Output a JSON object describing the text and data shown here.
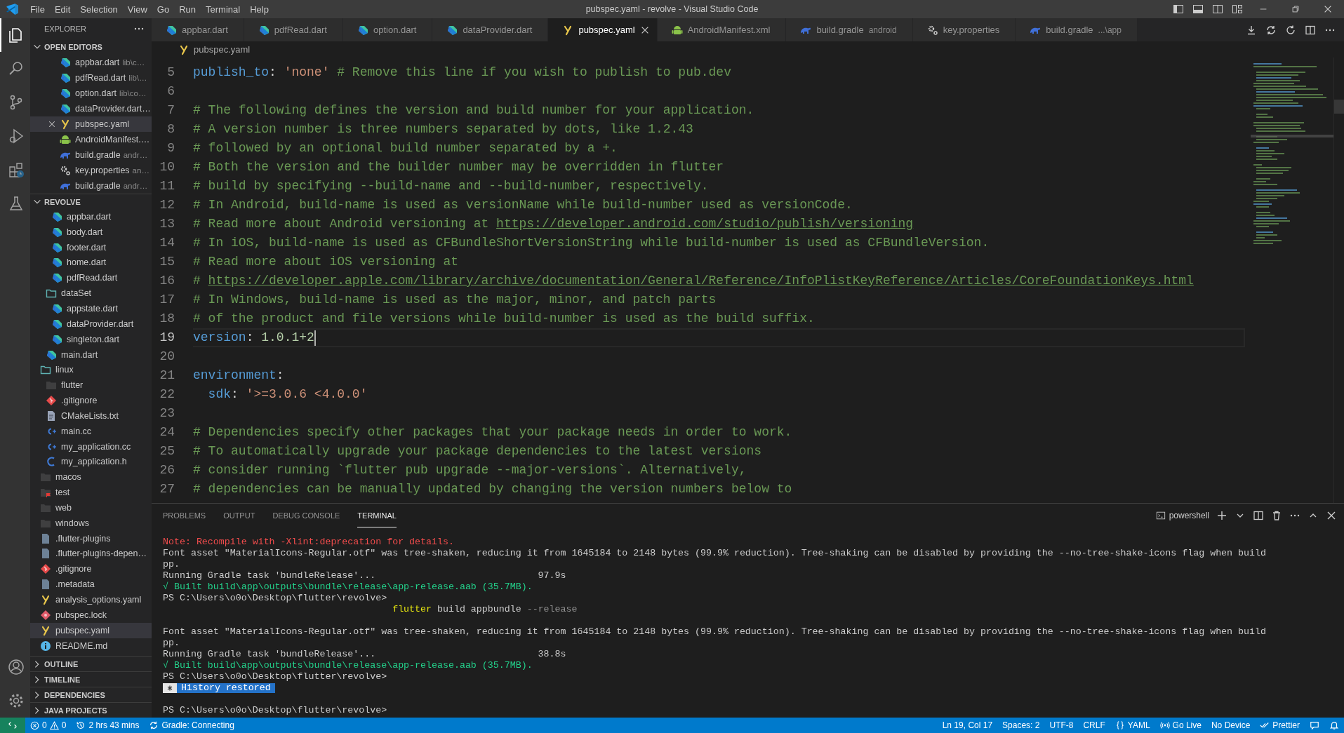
{
  "menu": [
    "File",
    "Edit",
    "Selection",
    "View",
    "Go",
    "Run",
    "Terminal",
    "Help"
  ],
  "window": {
    "title": "pubspec.yaml - revolve - Visual Studio Code"
  },
  "activity_bar": [
    {
      "kind": "explorer",
      "selected": true
    },
    {
      "kind": "search",
      "selected": false
    },
    {
      "kind": "source-control",
      "selected": false
    },
    {
      "kind": "run-debug",
      "selected": false
    },
    {
      "kind": "extensions",
      "selected": false
    },
    {
      "kind": "testing",
      "selected": false
    }
  ],
  "activity_bar_bottom": [
    {
      "kind": "account"
    },
    {
      "kind": "settings"
    }
  ],
  "sidebar": {
    "title": "EXPLORER",
    "open_editors": {
      "title": "OPEN EDITORS",
      "expanded": true,
      "items": [
        {
          "name": "appbar.dart",
          "description": "lib\\c…",
          "kind": "dart",
          "selected": false
        },
        {
          "name": "pdfRead.dart",
          "description": "lib\\…",
          "kind": "dart",
          "selected": false
        },
        {
          "name": "option.dart",
          "description": "lib\\co…",
          "kind": "dart",
          "selected": false
        },
        {
          "name": "dataProvider.dart…",
          "kind": "dart",
          "selected": false
        },
        {
          "name": "pubspec.yaml",
          "kind": "yaml",
          "selected": true
        },
        {
          "name": "AndroidManifest.…",
          "kind": "android",
          "selected": false
        },
        {
          "name": "build.gradle",
          "description": "andr…",
          "kind": "gradle",
          "selected": false
        },
        {
          "name": "key.properties",
          "description": "an…",
          "kind": "gear",
          "selected": false
        },
        {
          "name": "build.gradle",
          "description": "andr…",
          "kind": "gradle",
          "selected": false
        }
      ]
    },
    "project": {
      "title": "REVOLVE",
      "expanded": true,
      "tree": [
        {
          "children": [
            {
              "children": [
                {
                  "name": "appbar.dart",
                  "kind": "dart",
                  "selected": false
                },
                {
                  "name": "body.dart",
                  "kind": "dart",
                  "selected": false
                },
                {
                  "name": "footer.dart",
                  "kind": "dart",
                  "selected": false
                },
                {
                  "name": "home.dart",
                  "kind": "dart",
                  "selected": false
                },
                {
                  "name": "pdfRead.dart",
                  "kind": "dart",
                  "selected": false
                }
              ]
            },
            {
              "name": "dataSet",
              "kind": "folder",
              "expanded": true,
              "selected": false,
              "children": [
                {
                  "name": "appstate.dart",
                  "kind": "dart",
                  "selected": false
                },
                {
                  "name": "dataProvider.dart",
                  "kind": "dart",
                  "selected": false
                },
                {
                  "name": "singleton.dart",
                  "kind": "dart",
                  "selected": false
                }
              ]
            },
            {
              "name": "main.dart",
              "kind": "dart",
              "selected": false
            }
          ]
        },
        {
          "name": "linux",
          "kind": "folder",
          "expanded": true,
          "selected": false,
          "children": [
            {
              "name": "flutter",
              "kind": "folder",
              "expanded": false,
              "selected": false
            },
            {
              "name": ".gitignore",
              "kind": "git",
              "selected": false
            },
            {
              "name": "CMakeLists.txt",
              "kind": "text",
              "selected": false
            },
            {
              "name": "main.cc",
              "kind": "cpp",
              "selected": false
            },
            {
              "name": "my_application.cc",
              "kind": "cpp",
              "selected": false
            },
            {
              "name": "my_application.h",
              "kind": "c",
              "selected": false
            }
          ]
        },
        {
          "name": "macos",
          "kind": "folder",
          "expanded": false,
          "selected": false
        },
        {
          "name": "test",
          "kind": "test-folder",
          "expanded": false,
          "selected": false
        },
        {
          "name": "web",
          "kind": "folder",
          "expanded": false,
          "selected": false
        },
        {
          "name": "windows",
          "kind": "folder",
          "expanded": false,
          "selected": false
        },
        {
          "name": ".flutter-plugins",
          "kind": "file",
          "selected": false
        },
        {
          "name": ".flutter-plugins-depen…",
          "kind": "file",
          "selected": false
        },
        {
          "name": ".gitignore",
          "kind": "git",
          "selected": false
        },
        {
          "name": ".metadata",
          "kind": "file",
          "selected": false
        },
        {
          "name": "analysis_options.yaml",
          "kind": "yaml",
          "selected": false
        },
        {
          "name": "pubspec.lock",
          "kind": "lock",
          "selected": false
        },
        {
          "name": "pubspec.yaml",
          "kind": "yaml",
          "selected": true
        },
        {
          "name": "README.md",
          "kind": "info",
          "selected": false
        }
      ]
    },
    "sections": [
      {
        "title": "OUTLINE",
        "expanded": false
      },
      {
        "title": "TIMELINE",
        "expanded": false
      },
      {
        "title": "DEPENDENCIES",
        "expanded": false
      },
      {
        "title": "JAVA PROJECTS",
        "expanded": false
      }
    ]
  },
  "tabs": [
    {
      "label": "appbar.dart",
      "kind": "dart",
      "selected": false
    },
    {
      "label": "pdfRead.dart",
      "kind": "dart",
      "selected": false
    },
    {
      "label": "option.dart",
      "kind": "dart",
      "selected": false
    },
    {
      "label": "dataProvider.dart",
      "kind": "dart",
      "selected": false
    },
    {
      "label": "pubspec.yaml",
      "kind": "yaml",
      "selected": true
    },
    {
      "label": "AndroidManifest.xml",
      "kind": "android",
      "selected": false
    },
    {
      "label": "build.gradle",
      "description": "android",
      "kind": "gradle",
      "selected": false
    },
    {
      "label": "key.properties",
      "kind": "gear",
      "selected": false
    },
    {
      "label": "build.gradle",
      "description": "...\\app",
      "kind": "gradle",
      "selected": false
    }
  ],
  "breadcrumb": {
    "label": "pubspec.yaml",
    "kind": "yaml"
  },
  "editor": {
    "lines": [
      {
        "num": "5",
        "kind": "top",
        "current": false,
        "tokens": [
          {
            "kind": "key",
            "text": "publish_to"
          },
          {
            "kind": "punct",
            "text": ": "
          },
          {
            "kind": "string",
            "text": "'none'"
          },
          {
            "kind": "comment",
            "text": " # Remove this line if you wish to publish to pub.dev"
          }
        ]
      },
      {
        "num": "6",
        "kind": "top",
        "current": false
      },
      {
        "num": "7",
        "kind": "top",
        "current": false,
        "tokens": [
          {
            "kind": "comment",
            "text": "# The following defines the version and build number for your application."
          }
        ]
      },
      {
        "num": "8",
        "kind": "top",
        "current": false,
        "tokens": [
          {
            "kind": "comment",
            "text": "# A version number is three numbers separated by dots, like 1.2.43"
          }
        ]
      },
      {
        "num": "9",
        "kind": "top",
        "current": false,
        "tokens": [
          {
            "kind": "comment",
            "text": "# followed by an optional build number separated by a +."
          }
        ]
      },
      {
        "num": "10",
        "kind": "top",
        "current": false,
        "tokens": [
          {
            "kind": "comment",
            "text": "# Both the version and the builder number may be overridden in flutter"
          }
        ]
      },
      {
        "num": "11",
        "kind": "top",
        "current": false,
        "tokens": [
          {
            "kind": "comment",
            "text": "# build by specifying --build-name and --build-number, respectively."
          }
        ]
      },
      {
        "num": "12",
        "kind": "top",
        "current": false,
        "tokens": [
          {
            "kind": "comment",
            "text": "# In Android, build-name is used as versionName while build-number used as versionCode."
          }
        ]
      },
      {
        "num": "13",
        "kind": "top",
        "current": false,
        "tokens": [
          {
            "kind": "comment",
            "text": "# Read more about Android versioning at "
          },
          {
            "kind": "link",
            "text": "https://developer.android.com/studio/publish/versioning"
          }
        ]
      },
      {
        "num": "14",
        "kind": "top",
        "current": false,
        "tokens": [
          {
            "kind": "comment",
            "text": "# In iOS, build-name is used as CFBundleShortVersionString while build-number is used as CFBundleVersion."
          }
        ]
      },
      {
        "num": "15",
        "kind": "top",
        "current": false,
        "tokens": [
          {
            "kind": "comment",
            "text": "# Read more about iOS versioning at"
          }
        ]
      },
      {
        "num": "16",
        "kind": "top",
        "current": false,
        "tokens": [
          {
            "kind": "comment",
            "text": "# "
          },
          {
            "kind": "link",
            "text": "https://developer.apple.com/library/archive/documentation/General/Reference/InfoPlistKeyReference/Articles/CoreFoundationKeys.html"
          }
        ]
      },
      {
        "num": "17",
        "kind": "top",
        "current": false,
        "tokens": [
          {
            "kind": "comment",
            "text": "# In Windows, build-name is used as the major, minor, and patch parts"
          }
        ]
      },
      {
        "num": "18",
        "kind": "top",
        "current": false,
        "tokens": [
          {
            "kind": "comment",
            "text": "# of the product and file versions while build-number is used as the build suffix."
          }
        ]
      },
      {
        "num": "19",
        "kind": "top",
        "current": true,
        "tokens": [
          {
            "kind": "key",
            "text": "version"
          },
          {
            "kind": "punct",
            "text": ": "
          },
          {
            "kind": "number",
            "text": "1.0.1+2"
          }
        ]
      },
      {
        "num": "20",
        "kind": "top",
        "current": false
      },
      {
        "num": "21",
        "kind": "top",
        "current": false,
        "tokens": [
          {
            "kind": "key",
            "text": "environment"
          },
          {
            "kind": "punct",
            "text": ":"
          }
        ]
      },
      {
        "num": "22",
        "kind": "nested",
        "current": false,
        "tokens": [
          {
            "kind": "key",
            "text": "sdk"
          },
          {
            "kind": "punct",
            "text": ": "
          },
          {
            "kind": "string",
            "text": "'>=3.0.6 <4.0.0'"
          }
        ]
      },
      {
        "num": "23",
        "kind": "top",
        "current": false
      },
      {
        "num": "24",
        "kind": "top",
        "current": false,
        "tokens": [
          {
            "kind": "comment",
            "text": "# Dependencies specify other packages that your package needs in order to work."
          }
        ]
      },
      {
        "num": "25",
        "kind": "top",
        "current": false,
        "tokens": [
          {
            "kind": "comment",
            "text": "# To automatically upgrade your package dependencies to the latest versions"
          }
        ]
      },
      {
        "num": "26",
        "kind": "top",
        "current": false,
        "tokens": [
          {
            "kind": "comment",
            "text": "# consider running `flutter pub upgrade --major-versions`. Alternatively,"
          }
        ]
      },
      {
        "num": "27",
        "kind": "top",
        "current": false,
        "tokens": [
          {
            "kind": "comment",
            "text": "# dependencies can be manually updated by changing the version numbers below to"
          }
        ]
      }
    ]
  },
  "panel": {
    "tabs": [
      {
        "label": "PROBLEMS",
        "selected": false
      },
      {
        "label": "OUTPUT",
        "selected": false
      },
      {
        "label": "DEBUG CONSOLE",
        "selected": false
      },
      {
        "label": "TERMINAL",
        "selected": true
      }
    ],
    "terminal_name": "powershell",
    "terminal": [
      {
        "kind": "error",
        "text": "Note: Recompile with -Xlint:deprecation for details."
      },
      {
        "kind": "output",
        "text": "Font asset \"MaterialIcons-Regular.otf\" was tree-shaken, reducing it from 1645184 to 2148 bytes (99.9% reduction). Tree-shaking can be disabled by providing the --no-tree-shake-icons flag when build"
      },
      {
        "kind": "output",
        "text": "pp."
      },
      {
        "kind": "timed",
        "text": "Running Gradle task 'bundleRelease'...",
        "time": "97.9s"
      },
      {
        "kind": "success",
        "text": "√ Built build\\app\\outputs\\bundle\\release\\app-release.aab (35.7MB)."
      },
      {
        "kind": "output",
        "text": "PS C:\\Users\\o0o\\Desktop\\flutter\\revolve>"
      },
      {
        "kind": "command",
        "tokens": [
          {
            "kind": "exe",
            "text": "flutter"
          },
          {
            "kind": "arg",
            "text": " build appbundle "
          },
          {
            "kind": "flag",
            "text": "--release"
          }
        ]
      },
      {
        "kind": "blank"
      },
      {
        "kind": "output",
        "text": "Font asset \"MaterialIcons-Regular.otf\" was tree-shaken, reducing it from 1645184 to 2148 bytes (99.9% reduction). Tree-shaking can be disabled by providing the --no-tree-shake-icons flag when build"
      },
      {
        "kind": "output",
        "text": "pp."
      },
      {
        "kind": "timed",
        "text": "Running Gradle task 'bundleRelease'...",
        "time": "38.8s"
      },
      {
        "kind": "success",
        "text": "√ Built build\\app\\outputs\\bundle\\release\\app-release.aab (35.7MB)."
      },
      {
        "kind": "output",
        "text": "PS C:\\Users\\o0o\\Desktop\\flutter\\revolve>"
      },
      {
        "kind": "badge",
        "text": "History restored"
      },
      {
        "kind": "blank"
      },
      {
        "kind": "output",
        "text": "PS C:\\Users\\o0o\\Desktop\\flutter\\revolve>"
      }
    ]
  },
  "status_bar": {
    "left": [
      {
        "kind": "remote"
      },
      {
        "kind": "problems",
        "errors": "0",
        "warnings": "0"
      },
      {
        "kind": "history",
        "text": "2 hrs 43 mins"
      },
      {
        "kind": "sync",
        "text": "Gradle: Connecting"
      }
    ],
    "right": [
      {
        "kind": "text",
        "text": "Ln 19, Col 17"
      },
      {
        "kind": "text",
        "text": "Spaces: 2"
      },
      {
        "kind": "text",
        "text": "UTF-8"
      },
      {
        "kind": "text",
        "text": "CRLF"
      },
      {
        "kind": "braces",
        "text": "YAML"
      },
      {
        "kind": "broadcast",
        "text": "Go Live"
      },
      {
        "kind": "text",
        "text": "No Device"
      },
      {
        "kind": "checks",
        "text": "Prettier"
      },
      {
        "kind": "feedback"
      },
      {
        "kind": "bell"
      }
    ]
  }
}
